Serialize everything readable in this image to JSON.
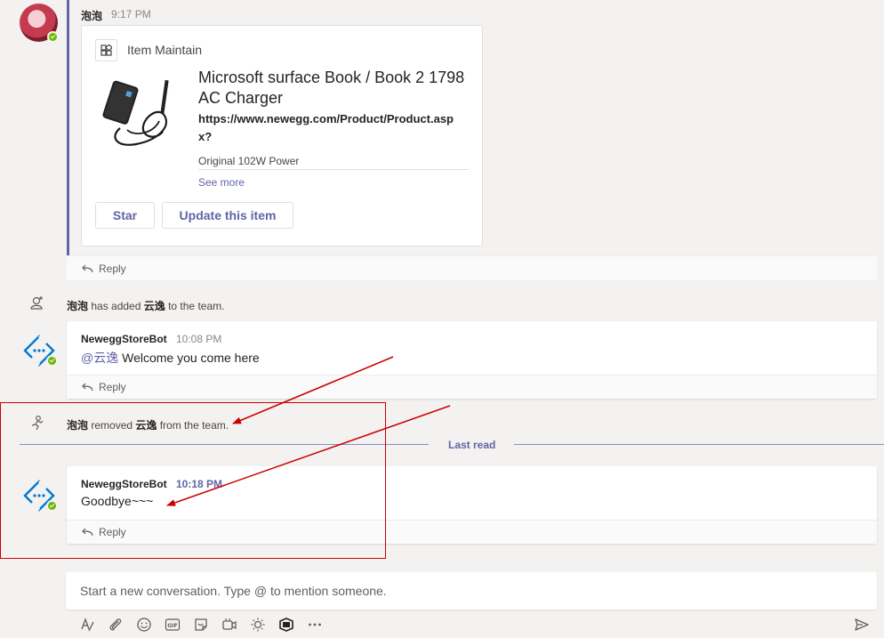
{
  "message1": {
    "sender": "泡泡",
    "time": "9:17 PM",
    "card": {
      "app_name": "Item Maintain",
      "title": "Microsoft surface Book / Book 2 1798 AC Charger",
      "url": "https://www.newegg.com/Product/Product.aspx?",
      "description": "Original 102W Power",
      "see_more": "See more",
      "buttons": [
        "Star",
        "Update this item"
      ]
    },
    "reply": "Reply"
  },
  "system1": {
    "actor": "泡泡",
    "action": " has added ",
    "target": "云逸",
    "tail": " to the team."
  },
  "message2": {
    "sender": "NeweggStoreBot",
    "time": "10:08 PM",
    "mention": "@云逸",
    "text": " Welcome you come here",
    "reply": "Reply"
  },
  "system2": {
    "actor": "泡泡",
    "action": " removed ",
    "target": "云逸",
    "tail": " from the team."
  },
  "divider": {
    "label": "Last read"
  },
  "message3": {
    "sender": "NeweggStoreBot",
    "time": "10:18 PM",
    "text": "Goodbye~~~",
    "reply": "Reply"
  },
  "compose": {
    "placeholder": "Start a new conversation. Type @ to mention someone."
  },
  "toolbar": [
    "format-icon",
    "attach-icon",
    "emoji-icon",
    "gif-icon",
    "sticker-icon",
    "meet-now-icon",
    "praise-icon",
    "stream-icon",
    "more-options-icon",
    "send-icon"
  ],
  "colors": {
    "accent": "#6264a7",
    "presence": "#6bb700",
    "annotation": "#cc0000",
    "background": "#f3f2f1"
  }
}
